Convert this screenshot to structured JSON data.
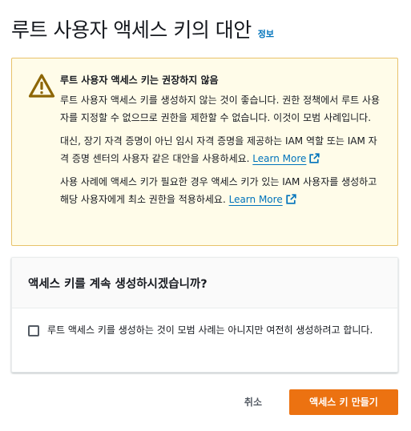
{
  "header": {
    "title": "루트 사용자 액세스 키의 대안",
    "info_label": "정보"
  },
  "alert": {
    "icon": "warning-icon",
    "title": "루트 사용자 액세스 키는 권장하지 않음",
    "paragraph1": "루트 사용자 액세스 키를 생성하지 않는 것이 좋습니다. 권한 정책에서 루트 사용자를 지정할 수 없으므로 권한을 제한할 수 없습니다. 이것이 모범 사례입니다.",
    "paragraph2": "대신, 장기 자격 증명이 아닌 임시 자격 증명을 제공하는 IAM 역할 또는 IAM 자격 증명 센터의 사용자 같은 대안을 사용하세요.",
    "paragraph3": "사용 사례에 액세스 키가 필요한 경우 액세스 키가 있는 IAM 사용자를 생성하고 해당 사용자에게 최소 권한을 적용하세요.",
    "learn_more_label": "Learn More",
    "link_icon": "external-link-icon"
  },
  "confirm": {
    "title": "액세스 키를 계속 생성하시겠습니까?",
    "checkbox_label": "루트 액세스 키를 생성하는 것이 모범 사례는 아니지만 여전히 생성하려고 합니다.",
    "checked": false
  },
  "actions": {
    "cancel_label": "취소",
    "create_label": "액세스 키 만들기"
  },
  "colors": {
    "accent_orange": "#ec7211",
    "link_blue": "#0073bb",
    "warning_bg": "#fffce9",
    "warning_border": "#e8c26a",
    "warning_icon": "#8d6605"
  }
}
